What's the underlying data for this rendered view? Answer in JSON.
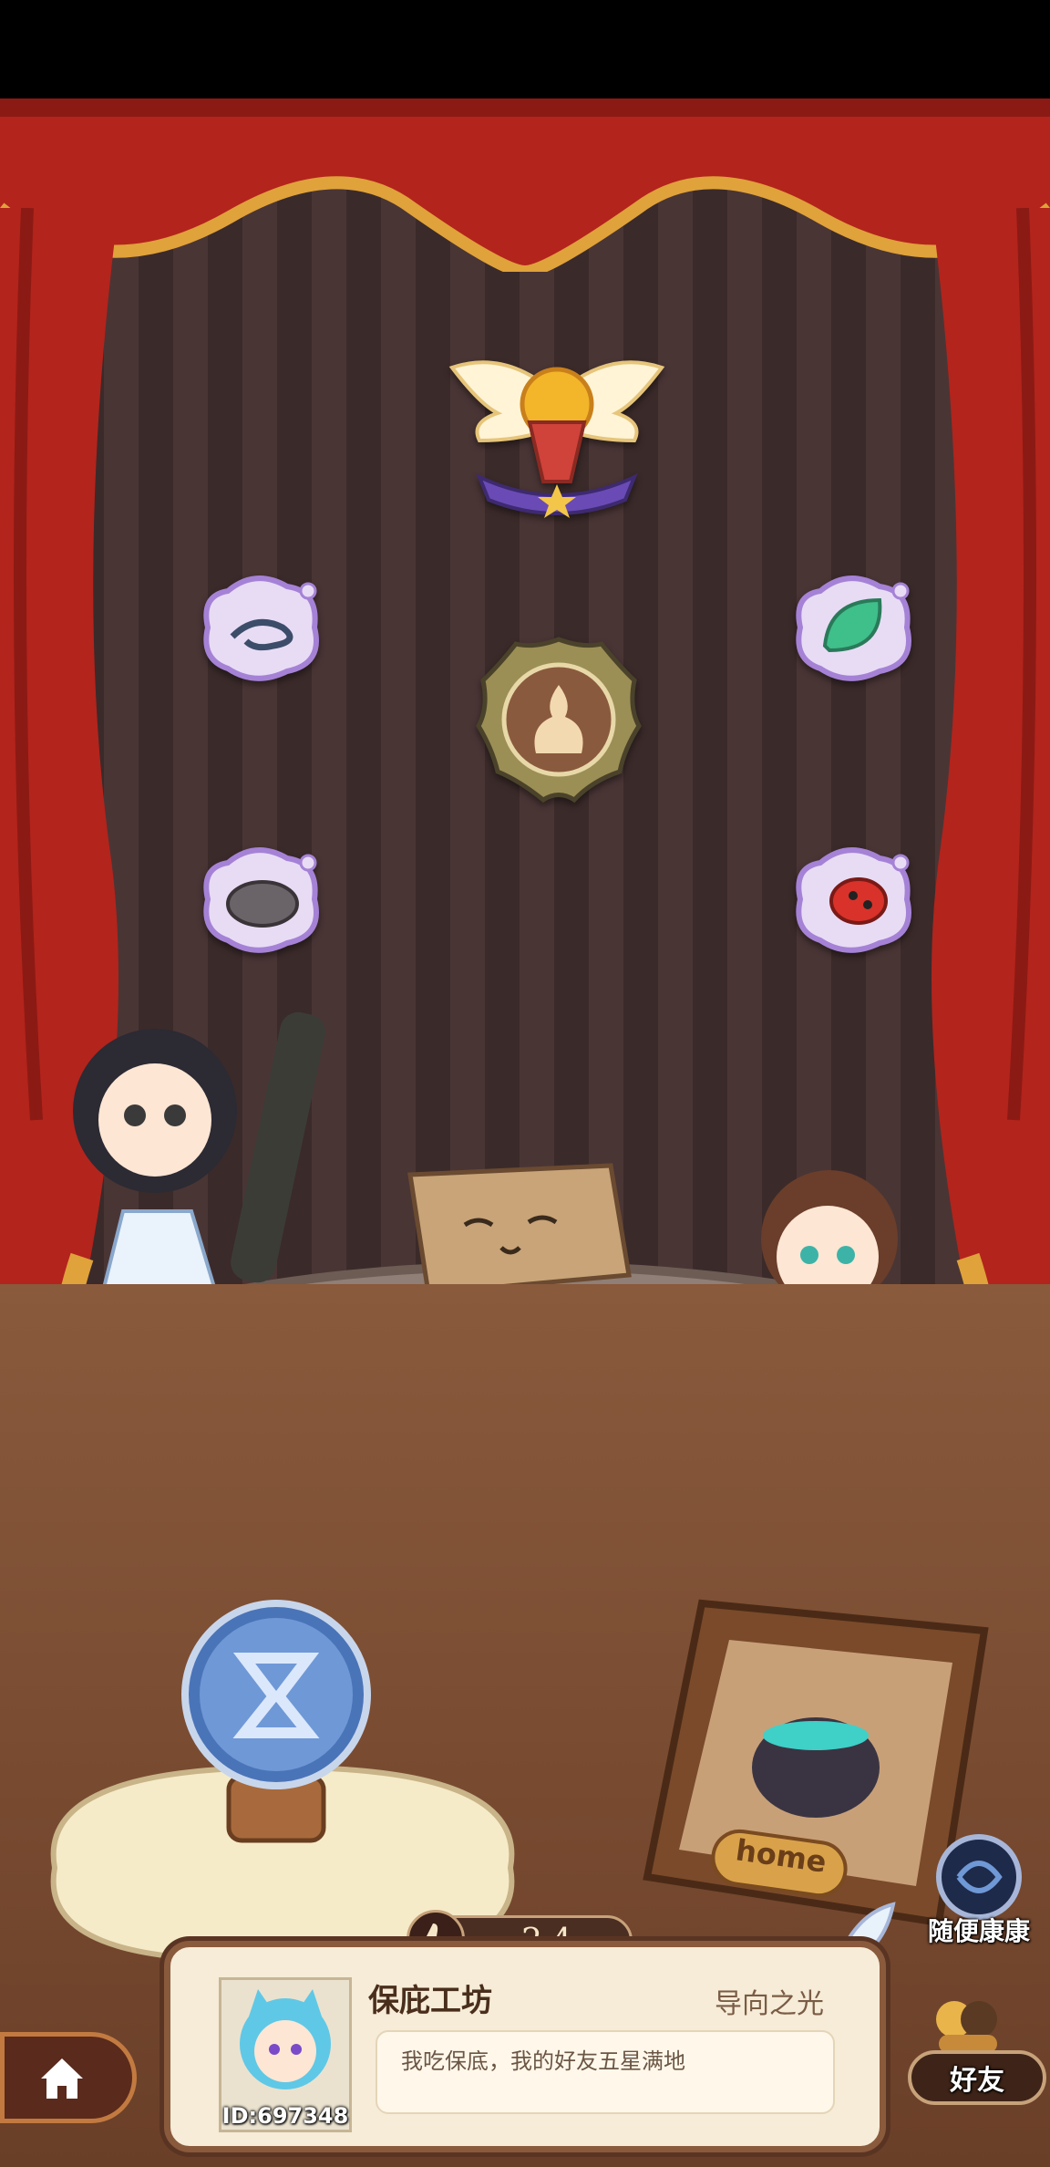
{
  "likes": {
    "count": "24"
  },
  "profile": {
    "name": "保庇工坊",
    "title": "导向之光",
    "signature": "我吃保底，我的好友五星满地",
    "id_text": "ID:697348"
  },
  "actions": {
    "random_visit": "随便康康",
    "friends": "好友",
    "home_sign": "home"
  },
  "colors": {
    "curtain_red": "#b3241c",
    "curtain_gold": "#e0a23a",
    "stage_brown": "#6a4a3a",
    "panel_cream": "#f6ecd8"
  },
  "icons": {
    "center_trophy": "winged-trophy-icon",
    "center_medal": "fairy-medal-icon",
    "badges": [
      "water-splash-icon",
      "leaf-icon",
      "rock-beetle-icon",
      "ladybug-icon"
    ],
    "crystal_ball": "hourglass-crystal-ball-icon",
    "home": "house-icon",
    "like": "thumbs-up-icon",
    "feather": "feather-quill-icon"
  }
}
